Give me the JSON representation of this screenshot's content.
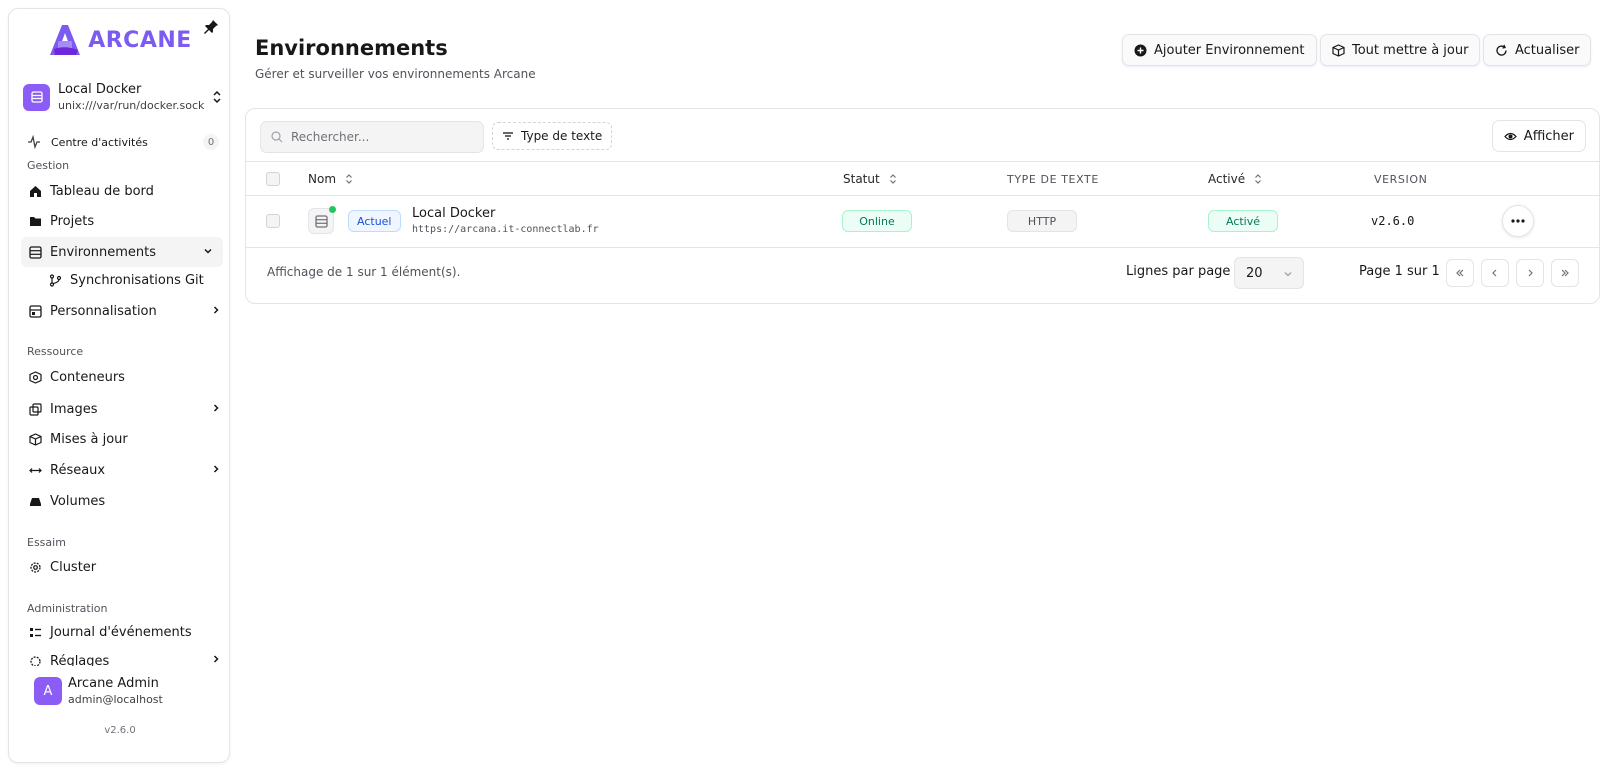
{
  "brand": {
    "name": "ARCANE",
    "color": "#7c5cf0"
  },
  "environment_switcher": {
    "name": "Local Docker",
    "socket": "unix:///var/run/docker.sock"
  },
  "activity": {
    "label": "Centre d'activités",
    "count": "0"
  },
  "sections": {
    "gestion": "Gestion",
    "ressource": "Ressource",
    "essaim": "Essaim",
    "administration": "Administration"
  },
  "nav": {
    "dashboard": "Tableau de bord",
    "projects": "Projets",
    "environments": "Environnements",
    "git_sync": "Synchronisations Git",
    "customization": "Personnalisation",
    "containers": "Conteneurs",
    "images": "Images",
    "updates": "Mises à jour",
    "networks": "Réseaux",
    "volumes": "Volumes",
    "cluster": "Cluster",
    "event_log": "Journal d'événements",
    "settings": "Réglages"
  },
  "user": {
    "initial": "A",
    "name": "Arcane Admin",
    "email": "admin@localhost"
  },
  "app_version": "v2.6.0",
  "header": {
    "title": "Environnements",
    "subtitle": "Gérer et surveiller vos environnements Arcane",
    "add_label": "Ajouter Environnement",
    "update_all_label": "Tout mettre à jour",
    "refresh_label": "Actualiser"
  },
  "toolbar": {
    "search_placeholder": "Rechercher...",
    "filter_label": "Type de texte",
    "view_label": "Afficher"
  },
  "table": {
    "columns": {
      "name": "Nom",
      "status": "Statut",
      "type": "TYPE DE TEXTE",
      "enabled": "Activé",
      "version": "VERSION"
    },
    "rows": [
      {
        "badge": "Actuel",
        "name": "Local Docker",
        "url": "https://arcana.it-connectlab.fr",
        "status": "Online",
        "type": "HTTP",
        "enabled": "Activé",
        "version": "v2.6.0"
      }
    ]
  },
  "footer": {
    "summary": "Affichage de 1 sur 1 élément(s).",
    "rows_per_page_label": "Lignes par page",
    "rows_per_page_value": "20",
    "page_label": "Page 1 sur 1"
  }
}
